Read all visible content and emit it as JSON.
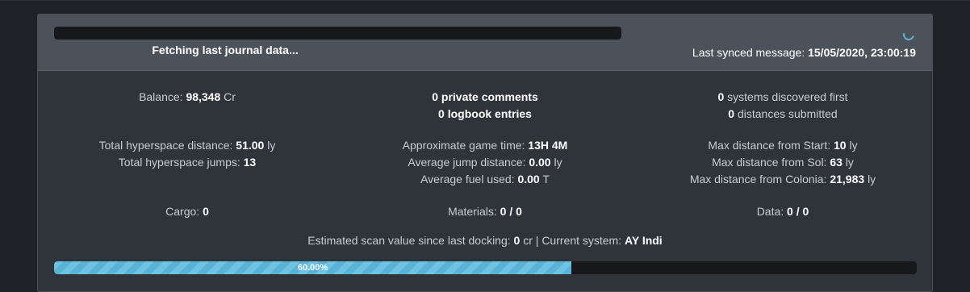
{
  "header": {
    "fetch_status": "Fetching last journal data...",
    "synced_label": "Last synced message:",
    "synced_value": "15/05/2020, 23:00:19"
  },
  "stats": {
    "balance_label": "Balance:",
    "balance_value": "98,348",
    "balance_unit": "Cr",
    "private_comments_value": "0",
    "private_comments_label": "private comments",
    "logbook_value": "0",
    "logbook_label": "logbook entries",
    "systems_first_value": "0",
    "systems_first_label": "systems discovered first",
    "distances_value": "0",
    "distances_label": "distances submitted",
    "hyper_distance_label": "Total hyperspace distance:",
    "hyper_distance_value": "51.00",
    "hyper_distance_unit": "ly",
    "hyper_jumps_label": "Total hyperspace jumps:",
    "hyper_jumps_value": "13",
    "game_time_label": "Approximate game time:",
    "game_time_value": "13H 4M",
    "avg_jump_label": "Average jump distance:",
    "avg_jump_value": "0.00",
    "avg_jump_unit": "ly",
    "avg_fuel_label": "Average fuel used:",
    "avg_fuel_value": "0.00",
    "avg_fuel_unit": "T",
    "max_start_label": "Max distance from Start:",
    "max_start_value": "10",
    "max_start_unit": "ly",
    "max_sol_label": "Max distance from Sol:",
    "max_sol_value": "63",
    "max_sol_unit": "ly",
    "max_colonia_label": "Max distance from Colonia:",
    "max_colonia_value": "21,983",
    "max_colonia_unit": "ly",
    "cargo_label": "Cargo:",
    "cargo_value": "0",
    "materials_label": "Materials:",
    "materials_value": "0 / 0",
    "data_label": "Data:",
    "data_value": "0 / 0"
  },
  "scan": {
    "label": "Estimated scan value since last docking:",
    "value": "0",
    "unit": "cr | Current system:",
    "system": "AY Indi"
  },
  "progress": {
    "fraction": 0.6,
    "label": "60.00%"
  },
  "colors": {
    "accent": "#6fc3e0",
    "panel": "#2f343b",
    "header": "#4b525a"
  }
}
